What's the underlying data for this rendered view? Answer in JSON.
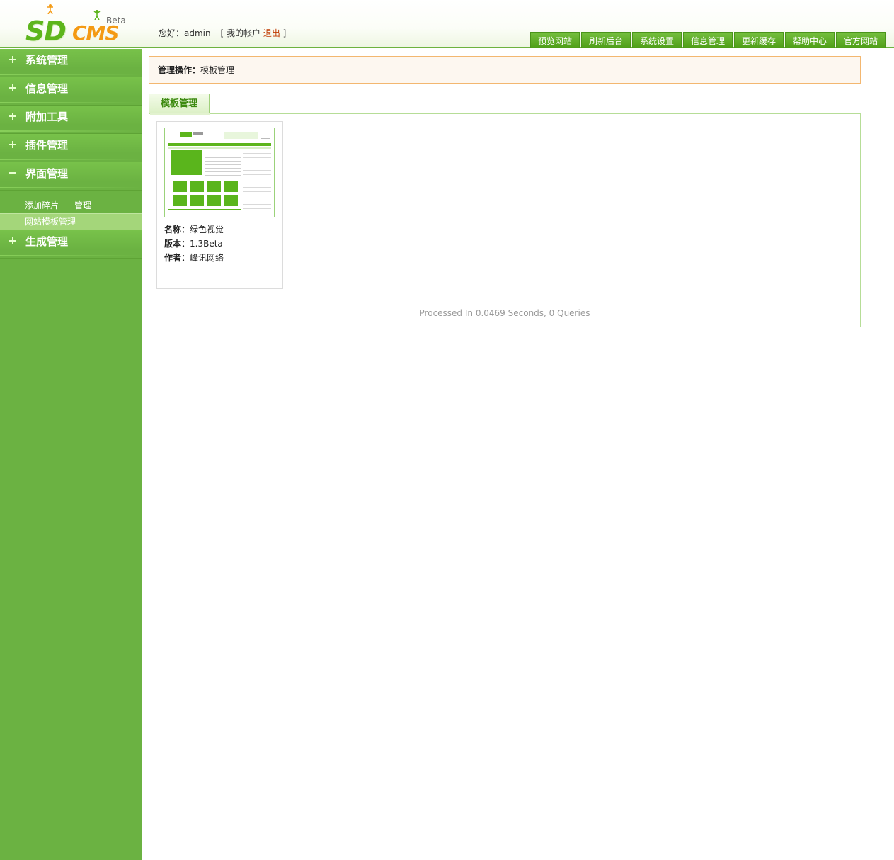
{
  "header": {
    "logo_text_1": "SD",
    "logo_text_2": "CMS",
    "logo_badge": "Beta",
    "greeting": "您好：",
    "username": "admin",
    "bracket_open": "[",
    "my_account": "我的帐户",
    "logout": "退出",
    "bracket_close": "]"
  },
  "topnav": [
    "预览网站",
    "刷新后台",
    "系统设置",
    "信息管理",
    "更新缓存",
    "帮助中心",
    "官方网站"
  ],
  "sidebar": {
    "groups": [
      {
        "label": "系统管理",
        "expanded": false
      },
      {
        "label": "信息管理",
        "expanded": false
      },
      {
        "label": "附加工具",
        "expanded": false
      },
      {
        "label": "插件管理",
        "expanded": false
      },
      {
        "label": "界面管理",
        "expanded": true
      },
      {
        "label": "生成管理",
        "expanded": false
      }
    ],
    "sub_items": {
      "add_fragment": "添加碎片",
      "manage": "管理",
      "site_template_manage": "网站模板管理"
    }
  },
  "main": {
    "op_label": "管理操作：",
    "op_value": "模板管理",
    "tab": "模板管理",
    "template": {
      "name_label": "名称：",
      "name": "绿色视觉",
      "version_label": "版本：",
      "version": "1.3Beta",
      "author_label": "作者：",
      "author": "峰讯网络"
    },
    "footer_note": "Processed In 0.0469 Seconds, 0 Queries"
  },
  "colors": {
    "sidebar_bg": "#6bb242",
    "accent_green": "#4e9e17",
    "logout_red": "#c03a00",
    "op_border": "#f3b770"
  }
}
